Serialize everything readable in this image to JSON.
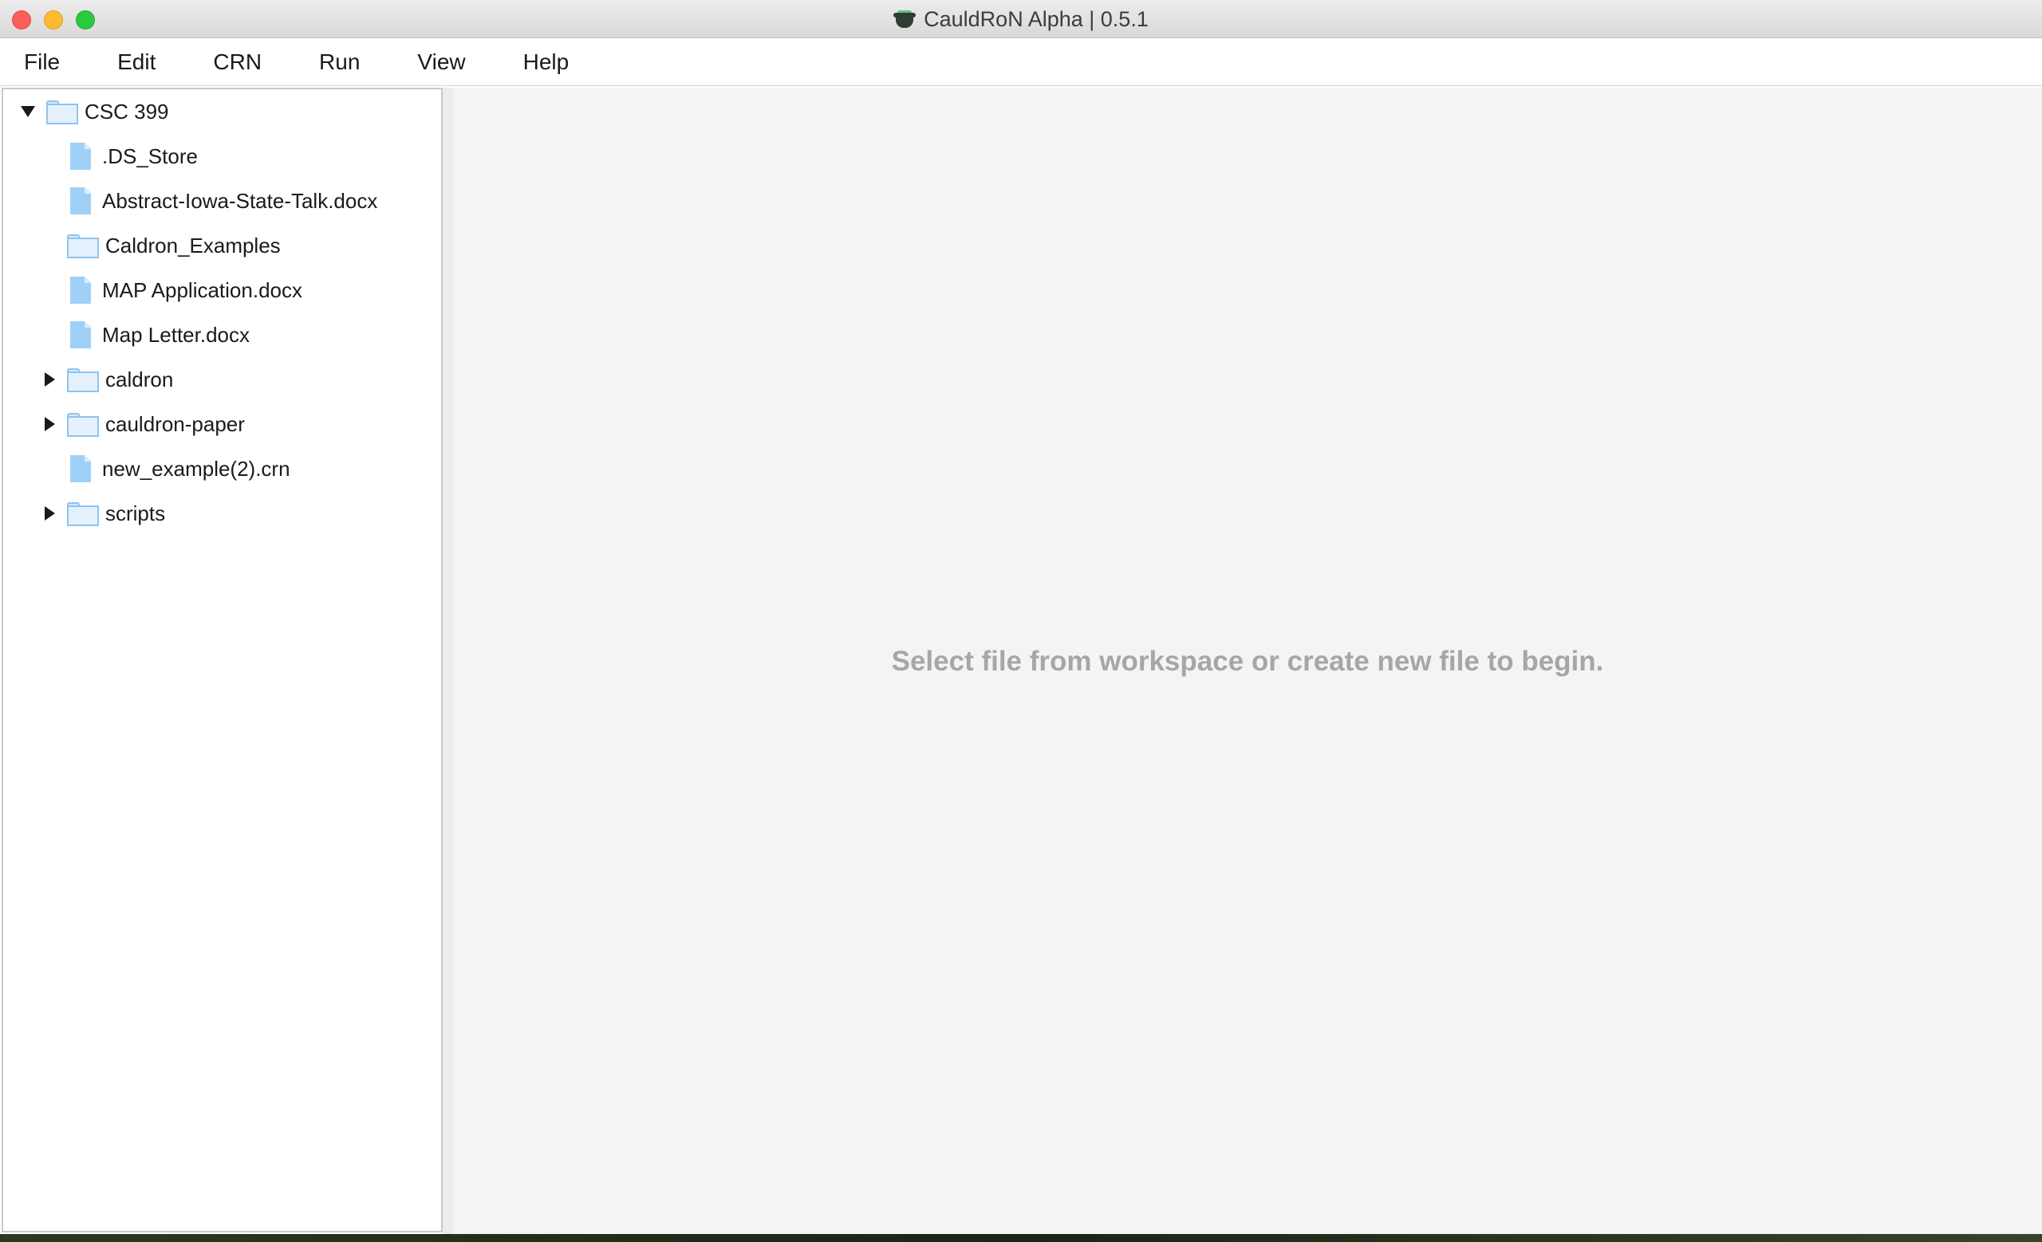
{
  "window": {
    "title": "CauldRoN Alpha | 0.5.1",
    "app_icon": "cauldron-icon"
  },
  "menubar": {
    "items": [
      {
        "label": "File"
      },
      {
        "label": "Edit"
      },
      {
        "label": "CRN"
      },
      {
        "label": "Run"
      },
      {
        "label": "View"
      },
      {
        "label": "Help"
      }
    ]
  },
  "workspace": {
    "root": {
      "label": "CSC 399",
      "type": "folder",
      "expanded": true
    },
    "children": [
      {
        "label": ".DS_Store",
        "type": "file"
      },
      {
        "label": "Abstract-Iowa-State-Talk.docx",
        "type": "file"
      },
      {
        "label": "Caldron_Examples",
        "type": "folder",
        "expandable": false
      },
      {
        "label": "MAP Application.docx",
        "type": "file"
      },
      {
        "label": "Map Letter.docx",
        "type": "file"
      },
      {
        "label": "caldron",
        "type": "folder",
        "expandable": true
      },
      {
        "label": "cauldron-paper",
        "type": "folder",
        "expandable": true
      },
      {
        "label": "new_example(2).crn",
        "type": "file"
      },
      {
        "label": "scripts",
        "type": "folder",
        "expandable": true
      }
    ]
  },
  "main": {
    "placeholder": "Select file from workspace or create new file to begin."
  },
  "colors": {
    "folder_fill": "#e4f1fc",
    "folder_border": "#8fc3ee",
    "file_fill": "#9fd0f7",
    "placeholder_text": "#a6a6a6",
    "main_background": "#f4f4f4"
  }
}
